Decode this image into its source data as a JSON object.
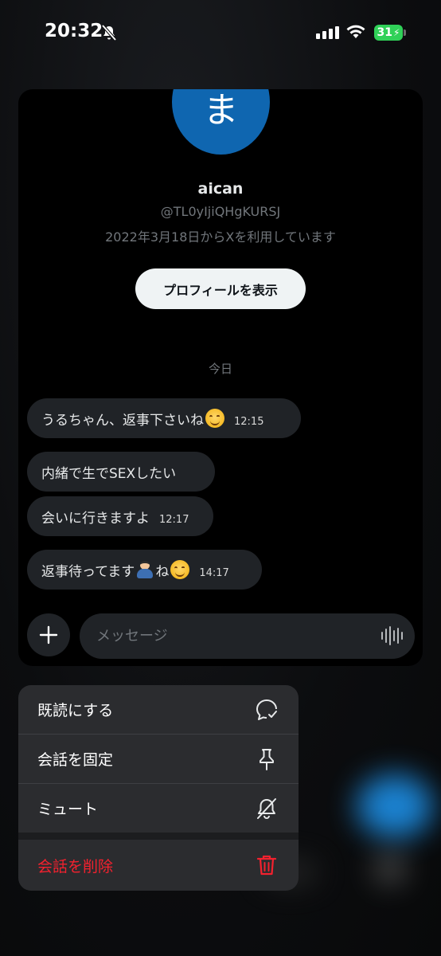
{
  "status_bar": {
    "time": "20:32",
    "battery": "31"
  },
  "profile": {
    "avatar_char": "ま",
    "name": "aican",
    "handle": "@TL0yIjiQHgKURSJ",
    "joined": "2022年3月18日からXを利用しています",
    "view_profile_label": "プロフィールを表示"
  },
  "date_separator": "今日",
  "messages": [
    {
      "text": "うるちゃん、返事下さいね",
      "time": "12:15"
    },
    {
      "text": "内緒で生でSEXしたい",
      "time": ""
    },
    {
      "text": "会いに行きますよ",
      "time": "12:17"
    },
    {
      "text_a": "返事待ってます",
      "text_b": "ね",
      "time": "14:17"
    }
  ],
  "composer": {
    "placeholder": "メッセージ"
  },
  "context_menu": {
    "items": [
      {
        "label": "既読にする",
        "icon": "read-check-icon"
      },
      {
        "label": "会話を固定",
        "icon": "pin-icon"
      },
      {
        "label": "ミュート",
        "icon": "mute-bell-icon"
      },
      {
        "label": "会話を削除",
        "icon": "trash-icon"
      }
    ]
  },
  "colors": {
    "danger": "#f4212e",
    "accent": "#1d9bf0",
    "bubble": "#202327",
    "avatar": "#0f66b0"
  }
}
